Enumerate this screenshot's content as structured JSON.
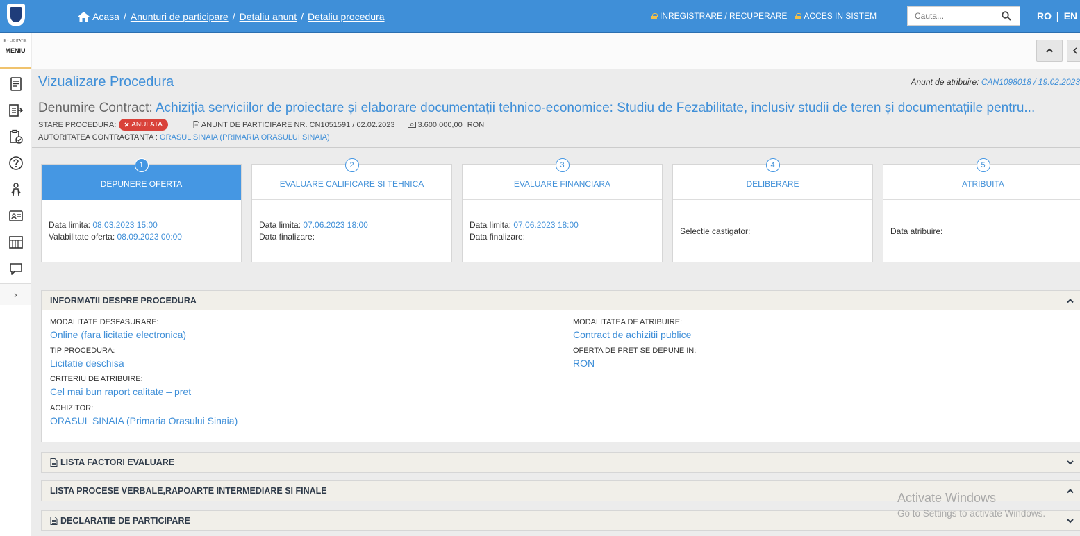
{
  "header": {
    "breadcrumbs": [
      {
        "label": "Acasa"
      },
      {
        "label": "Anunturi de participare"
      },
      {
        "label": "Detaliu anunt"
      },
      {
        "label": "Detaliu procedura"
      }
    ],
    "links": {
      "register": "INREGISTRARE / RECUPERARE",
      "login": "ACCES IN SISTEM"
    },
    "search_placeholder": "Cauta...",
    "lang_ro": "RO",
    "lang_sep": "|",
    "lang_en": "EN"
  },
  "sidebar": {
    "brand_small": "E - LICITATIE",
    "menu_label": "MENIU",
    "more": "›"
  },
  "page": {
    "title": "Vizualizare Procedura",
    "anunt_label": "Anunt de atribuire:",
    "anunt_value": "CAN1098018 / 19.02.2023",
    "contract_label": "Denumire Contract:",
    "contract_value": "Achiziția serviciilor de proiectare și elaborare documentații tehnico-economice: Studiu de Fezabilitate, inclusiv studii de teren și documentațiile pentru...",
    "stare_label": "STARE PROCEDURA:",
    "stare_value": "ANULATA",
    "anunt_participare": "ANUNT DE PARTICIPARE NR. CN1051591 / 02.02.2023",
    "valoare": "3.600.000,00",
    "moneda": "RON",
    "autoritate_label": "AUTORITATEA CONTRACTANTA :",
    "autoritate_value": "ORASUL SINAIA (PRIMARIA ORASULUI SINAIA)"
  },
  "steps": [
    {
      "num": "1",
      "title": "DEPUNERE OFERTA",
      "line1_label": "Data limita:",
      "line1_value": "08.03.2023 15:00",
      "line2_label": "Valabilitate oferta:",
      "line2_value": "08.09.2023 00:00"
    },
    {
      "num": "2",
      "title": "EVALUARE CALIFICARE SI TEHNICA",
      "line1_label": "Data limita:",
      "line1_value": "07.06.2023 18:00",
      "line2_label": "Data finalizare:",
      "line2_value": ""
    },
    {
      "num": "3",
      "title": "EVALUARE FINANCIARA",
      "line1_label": "Data limita:",
      "line1_value": "07.06.2023 18:00",
      "line2_label": "Data finalizare:",
      "line2_value": ""
    },
    {
      "num": "4",
      "title": "DELIBERARE",
      "line1_label": "Selectie castigator:",
      "line1_value": ""
    },
    {
      "num": "5",
      "title": "ATRIBUITA",
      "line1_label": "Data atribuire:",
      "line1_value": ""
    }
  ],
  "info": {
    "title": "INFORMATII DESPRE PROCEDURA",
    "fields": [
      {
        "label": "MODALITATE DESFASURARE:",
        "value": "Online (fara licitatie electronica)"
      },
      {
        "label": "TIP PROCEDURA:",
        "value": "Licitatie deschisa"
      },
      {
        "label": "CRITERIU DE ATRIBUIRE:",
        "value": "Cel mai bun raport calitate – pret"
      },
      {
        "label": "ACHIZITOR:",
        "value": "ORASUL SINAIA (Primaria Orasului Sinaia)"
      },
      {
        "label": "MODALITATEA DE ATRIBUIRE:",
        "value": "Contract de achizitii publice"
      },
      {
        "label": "OFERTA DE PRET SE DEPUNE IN:",
        "value": "RON"
      }
    ]
  },
  "panels": {
    "factori": "LISTA FACTORI EVALUARE",
    "procese": "LISTA PROCESE VERBALE,RAPOARTE INTERMEDIARE SI FINALE",
    "declaratie": "DECLARATIE DE PARTICIPARE"
  },
  "watermark": {
    "line1": "Activate Windows",
    "line2": "Go to Settings to activate Windows."
  },
  "colors": {
    "topbar": "#3f8fd8",
    "accent": "#3f8fd8",
    "badge": "#d9423a",
    "menu_underline": "#f0c36d"
  }
}
